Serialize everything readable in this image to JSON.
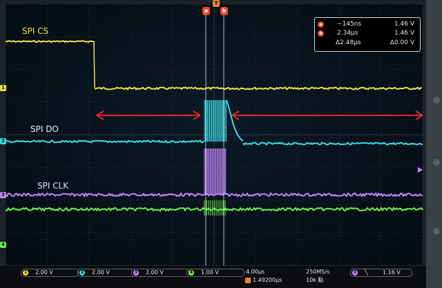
{
  "channels": [
    {
      "id": "1",
      "label": "SPI CS",
      "color": "#f2e24e"
    },
    {
      "id": "2",
      "label": "SPI DO",
      "color": "#38e0e4"
    },
    {
      "id": "3",
      "label": "SPI CLK",
      "color": "#c486ff"
    },
    {
      "id": "4",
      "label": "",
      "color": "#6cf04c"
    }
  ],
  "cursors": {
    "a": "a",
    "b": "b",
    "t_flag": "T"
  },
  "readout": {
    "row1": {
      "badge": "a",
      "time": "−145ns",
      "volts": "1.46 V"
    },
    "row2": {
      "badge": "b",
      "time": "2.34µs",
      "volts": "1.46 V"
    },
    "row3": {
      "time": "Δ2.48µs",
      "volts": "Δ0.00 V"
    }
  },
  "statusbar": {
    "ch1": {
      "num": "1",
      "scale": "2.00 V"
    },
    "ch2": {
      "num": "2",
      "scale": "2.00 V"
    },
    "ch3": {
      "num": "3",
      "scale": "2.00 V"
    },
    "ch4": {
      "num": "4",
      "scale": "1.00 V"
    },
    "timebase": "4.00µs",
    "trigger_pos": "1.49200µs",
    "sample_rate": "250MS/s",
    "record_length": "10k 點",
    "trigger_source": "3",
    "trigger_level": "1.16 V"
  },
  "colors": {
    "accent": "#e74a2e",
    "grid": "#4a5a6a",
    "background": "#06111b"
  }
}
